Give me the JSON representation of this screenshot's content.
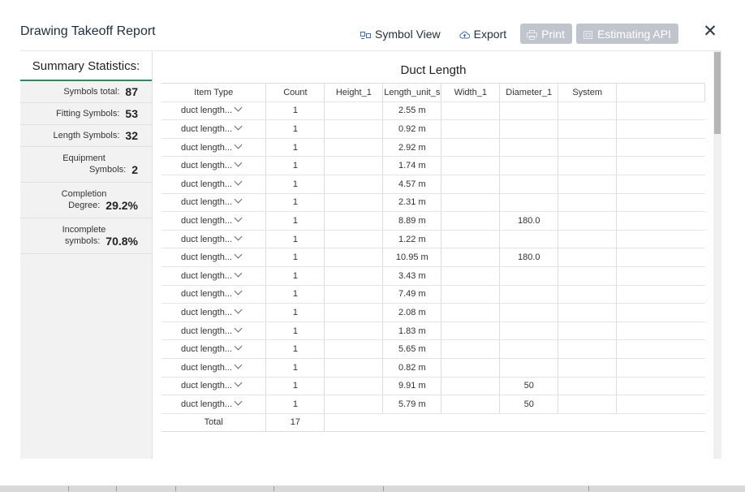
{
  "dialog": {
    "title": "Drawing Takeoff Report",
    "close_glyph": "✕"
  },
  "toolbar": {
    "symbol_view": "Symbol View",
    "export": "Export",
    "print": "Print",
    "estimating_api": "Estimating API"
  },
  "sidebar": {
    "heading": "Summary Statistics:",
    "stats": {
      "symbols_total": {
        "label": "Symbols total:",
        "value": "87"
      },
      "fitting": {
        "label": "Fitting Symbols:",
        "value": "53"
      },
      "length": {
        "label": "Length Symbols:",
        "value": "32"
      },
      "equipment": {
        "label1": "Equipment",
        "label2": "Symbols:",
        "value": "2"
      },
      "completion": {
        "label1": "Completion",
        "label2": "Degree:",
        "value": "29.2%"
      },
      "incomplete": {
        "label1": "Incomplete",
        "label2": "symbols:",
        "value": "70.8%"
      }
    }
  },
  "table": {
    "title": "Duct Length",
    "columns": [
      "Item Type",
      "Count",
      "Height_1",
      "Length_unit_s",
      "Width_1",
      "Diameter_1",
      "System"
    ],
    "rows": [
      {
        "item": "duct length...",
        "count": "1",
        "height": "",
        "length": "2.55 m",
        "width": "",
        "diameter": "",
        "system": ""
      },
      {
        "item": "duct length...",
        "count": "1",
        "height": "",
        "length": "0.92 m",
        "width": "",
        "diameter": "",
        "system": ""
      },
      {
        "item": "duct length...",
        "count": "1",
        "height": "",
        "length": "2.92 m",
        "width": "",
        "diameter": "",
        "system": ""
      },
      {
        "item": "duct length...",
        "count": "1",
        "height": "",
        "length": "1.74 m",
        "width": "",
        "diameter": "",
        "system": ""
      },
      {
        "item": "duct length...",
        "count": "1",
        "height": "",
        "length": "4.57 m",
        "width": "",
        "diameter": "",
        "system": ""
      },
      {
        "item": "duct length...",
        "count": "1",
        "height": "",
        "length": "2.31 m",
        "width": "",
        "diameter": "",
        "system": ""
      },
      {
        "item": "duct length...",
        "count": "1",
        "height": "",
        "length": "8.89 m",
        "width": "",
        "diameter": "180.0",
        "system": ""
      },
      {
        "item": "duct length...",
        "count": "1",
        "height": "",
        "length": "1.22 m",
        "width": "",
        "diameter": "",
        "system": ""
      },
      {
        "item": "duct length...",
        "count": "1",
        "height": "",
        "length": "10.95 m",
        "width": "",
        "diameter": "180.0",
        "system": ""
      },
      {
        "item": "duct length...",
        "count": "1",
        "height": "",
        "length": "3.43 m",
        "width": "",
        "diameter": "",
        "system": ""
      },
      {
        "item": "duct length...",
        "count": "1",
        "height": "",
        "length": "7.49 m",
        "width": "",
        "diameter": "",
        "system": ""
      },
      {
        "item": "duct length...",
        "count": "1",
        "height": "",
        "length": "2.08 m",
        "width": "",
        "diameter": "",
        "system": ""
      },
      {
        "item": "duct length...",
        "count": "1",
        "height": "",
        "length": "1.83 m",
        "width": "",
        "diameter": "",
        "system": ""
      },
      {
        "item": "duct length...",
        "count": "1",
        "height": "",
        "length": "5.65 m",
        "width": "",
        "diameter": "",
        "system": ""
      },
      {
        "item": "duct length...",
        "count": "1",
        "height": "",
        "length": "0.82 m",
        "width": "",
        "diameter": "",
        "system": ""
      },
      {
        "item": "duct length...",
        "count": "1",
        "height": "",
        "length": "9.91 m",
        "width": "",
        "diameter": "50",
        "system": ""
      },
      {
        "item": "duct length...",
        "count": "1",
        "height": "",
        "length": "5.79 m",
        "width": "",
        "diameter": "50",
        "system": ""
      }
    ],
    "total": {
      "label": "Total",
      "count": "17"
    }
  },
  "icons": {
    "symbol_view": "symbol-view-icon",
    "export": "cloud-upload-icon",
    "print": "printer-icon",
    "estimating_api": "api-icon",
    "close": "close-icon",
    "row_dropdown": "chevron-down-icon"
  },
  "colors": {
    "accent_underline": "#2e8b57",
    "disabled_button": "#c0c4cc",
    "sidebar_bg": "#f2f2f2"
  }
}
